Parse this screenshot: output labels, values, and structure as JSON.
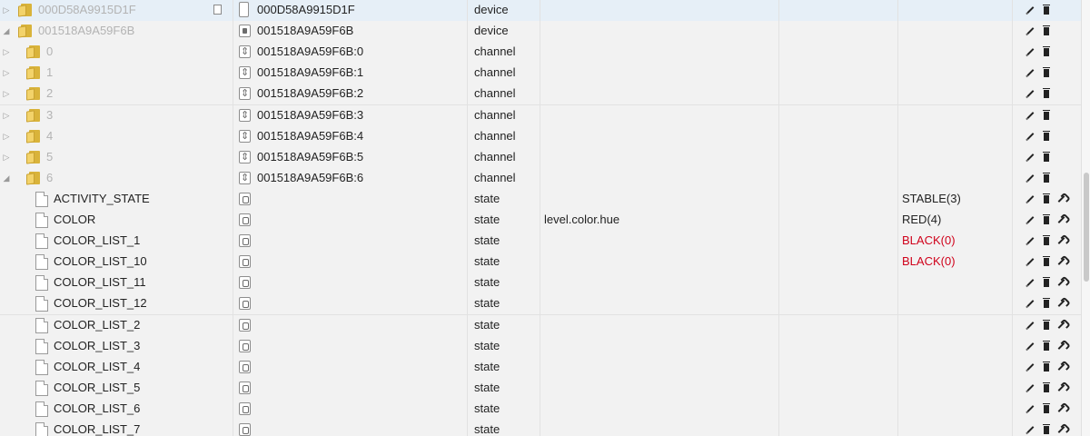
{
  "rows": [
    {
      "kind": "device",
      "level": 0,
      "expanded": false,
      "name": "000D58A9915D1F",
      "oname": "000D58A9915D1F",
      "type": "device",
      "role": "",
      "value": "",
      "value_color": "",
      "selected": true,
      "icon": "device-icon",
      "actions": [
        "edit",
        "delete"
      ]
    },
    {
      "kind": "device",
      "level": 0,
      "expanded": true,
      "name": "001518A9A59F6B",
      "oname": "001518A9A59F6B",
      "type": "device",
      "role": "",
      "value": "",
      "value_color": "",
      "selected": false,
      "icon": "device-icon",
      "actions": [
        "edit",
        "delete"
      ]
    },
    {
      "kind": "channel",
      "level": 1,
      "expanded": false,
      "name": "0",
      "oname": "001518A9A59F6B:0",
      "type": "channel",
      "role": "",
      "value": "",
      "value_color": "",
      "selected": false,
      "icon": "channel-icon",
      "actions": [
        "edit",
        "delete"
      ]
    },
    {
      "kind": "channel",
      "level": 1,
      "expanded": false,
      "name": "1",
      "oname": "001518A9A59F6B:1",
      "type": "channel",
      "role": "",
      "value": "",
      "value_color": "",
      "selected": false,
      "icon": "channel-icon",
      "actions": [
        "edit",
        "delete"
      ]
    },
    {
      "kind": "channel",
      "level": 1,
      "expanded": false,
      "name": "2",
      "oname": "001518A9A59F6B:2",
      "type": "channel",
      "role": "",
      "value": "",
      "value_color": "",
      "selected": false,
      "icon": "channel-icon",
      "actions": [
        "edit",
        "delete"
      ]
    },
    {
      "kind": "channel",
      "level": 1,
      "expanded": false,
      "name": "3",
      "oname": "001518A9A59F6B:3",
      "type": "channel",
      "role": "",
      "value": "",
      "value_color": "",
      "selected": false,
      "icon": "channel-icon",
      "actions": [
        "edit",
        "delete"
      ]
    },
    {
      "kind": "channel",
      "level": 1,
      "expanded": false,
      "name": "4",
      "oname": "001518A9A59F6B:4",
      "type": "channel",
      "role": "",
      "value": "",
      "value_color": "",
      "selected": false,
      "icon": "channel-icon",
      "actions": [
        "edit",
        "delete"
      ]
    },
    {
      "kind": "channel",
      "level": 1,
      "expanded": false,
      "name": "5",
      "oname": "001518A9A59F6B:5",
      "type": "channel",
      "role": "",
      "value": "",
      "value_color": "",
      "selected": false,
      "icon": "channel-icon",
      "actions": [
        "edit",
        "delete"
      ]
    },
    {
      "kind": "channel",
      "level": 1,
      "expanded": true,
      "name": "6",
      "oname": "001518A9A59F6B:6",
      "type": "channel",
      "role": "",
      "value": "",
      "value_color": "",
      "selected": false,
      "icon": "channel-icon",
      "actions": [
        "edit",
        "delete"
      ]
    },
    {
      "kind": "state",
      "level": 2,
      "name": "ACTIVITY_STATE",
      "oname": "",
      "type": "state",
      "role": "",
      "value": "STABLE(3)",
      "value_color": "#222222",
      "selected": false,
      "icon": "state-icon",
      "actions": [
        "edit",
        "delete",
        "settings"
      ]
    },
    {
      "kind": "state",
      "level": 2,
      "name": "COLOR",
      "oname": "",
      "type": "state",
      "role": "level.color.hue",
      "value": "RED(4)",
      "value_color": "#222222",
      "selected": false,
      "icon": "state-icon",
      "actions": [
        "edit",
        "delete",
        "settings"
      ]
    },
    {
      "kind": "state",
      "level": 2,
      "name": "COLOR_LIST_1",
      "oname": "",
      "type": "state",
      "role": "",
      "value": "BLACK(0)",
      "value_color": "#d0021b",
      "selected": false,
      "icon": "state-icon",
      "actions": [
        "edit",
        "delete",
        "settings"
      ]
    },
    {
      "kind": "state",
      "level": 2,
      "name": "COLOR_LIST_10",
      "oname": "",
      "type": "state",
      "role": "",
      "value": "BLACK(0)",
      "value_color": "#d0021b",
      "selected": false,
      "icon": "state-icon",
      "actions": [
        "edit",
        "delete",
        "settings"
      ]
    },
    {
      "kind": "state",
      "level": 2,
      "name": "COLOR_LIST_11",
      "oname": "",
      "type": "state",
      "role": "",
      "value": "",
      "value_color": "",
      "selected": false,
      "icon": "state-icon",
      "actions": [
        "edit",
        "delete",
        "settings"
      ]
    },
    {
      "kind": "state",
      "level": 2,
      "name": "COLOR_LIST_12",
      "oname": "",
      "type": "state",
      "role": "",
      "value": "",
      "value_color": "",
      "selected": false,
      "icon": "state-icon",
      "actions": [
        "edit",
        "delete",
        "settings"
      ]
    },
    {
      "kind": "state",
      "level": 2,
      "name": "COLOR_LIST_2",
      "oname": "",
      "type": "state",
      "role": "",
      "value": "",
      "value_color": "",
      "selected": false,
      "icon": "state-icon",
      "actions": [
        "edit",
        "delete",
        "settings"
      ]
    },
    {
      "kind": "state",
      "level": 2,
      "name": "COLOR_LIST_3",
      "oname": "",
      "type": "state",
      "role": "",
      "value": "",
      "value_color": "",
      "selected": false,
      "icon": "state-icon",
      "actions": [
        "edit",
        "delete",
        "settings"
      ]
    },
    {
      "kind": "state",
      "level": 2,
      "name": "COLOR_LIST_4",
      "oname": "",
      "type": "state",
      "role": "",
      "value": "",
      "value_color": "",
      "selected": false,
      "icon": "state-icon",
      "actions": [
        "edit",
        "delete",
        "settings"
      ]
    },
    {
      "kind": "state",
      "level": 2,
      "name": "COLOR_LIST_5",
      "oname": "",
      "type": "state",
      "role": "",
      "value": "",
      "value_color": "",
      "selected": false,
      "icon": "state-icon",
      "actions": [
        "edit",
        "delete",
        "settings"
      ]
    },
    {
      "kind": "state",
      "level": 2,
      "name": "COLOR_LIST_6",
      "oname": "",
      "type": "state",
      "role": "",
      "value": "",
      "value_color": "",
      "selected": false,
      "icon": "state-icon",
      "actions": [
        "edit",
        "delete",
        "settings"
      ]
    },
    {
      "kind": "state",
      "level": 2,
      "name": "COLOR_LIST_7",
      "oname": "",
      "type": "state",
      "role": "",
      "value": "",
      "value_color": "",
      "selected": false,
      "icon": "state-icon",
      "actions": [
        "edit",
        "delete",
        "settings"
      ]
    }
  ],
  "colors": {
    "selected_row": "#e6eff7",
    "folder": "#f3d36a",
    "value_red": "#d0021b"
  }
}
